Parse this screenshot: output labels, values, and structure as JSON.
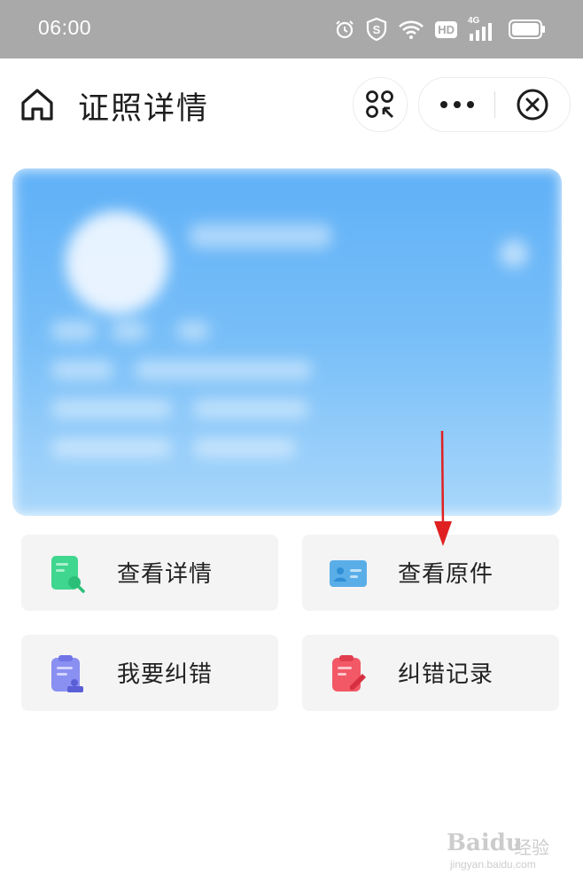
{
  "status_bar": {
    "time": "06:00",
    "icons": [
      "alarm-icon",
      "shield-s-icon",
      "wifi-icon",
      "hd-icon",
      "signal-4g-icon",
      "battery-icon"
    ],
    "hd_text": "HD",
    "network_text": "4G"
  },
  "header": {
    "title": "证照详情",
    "home_icon": "home-icon",
    "scan_icon": "scan-icon",
    "more_icon": "more-icon",
    "close_icon": "close-circle-icon"
  },
  "card": {
    "state": "blurred"
  },
  "actions": [
    {
      "label": "查看详情",
      "icon": "document-search-icon",
      "color": "#3fd68f"
    },
    {
      "label": "查看原件",
      "icon": "id-card-icon",
      "color": "#5aaee8"
    },
    {
      "label": "我要纠错",
      "icon": "clipboard-stamp-icon",
      "color": "#8a8ff2"
    },
    {
      "label": "纠错记录",
      "icon": "clipboard-edit-icon",
      "color": "#f25866"
    }
  ],
  "annotation": {
    "arrow_color": "#e02020"
  },
  "watermark": {
    "brand": "Baidu",
    "cn": "经验",
    "url": "jingyan.baidu.com"
  },
  "colors": {
    "status_bar": "#a9a9a9",
    "card_gradient_top": "#5fb0f7",
    "card_gradient_bottom": "#a9d7fb",
    "action_bg": "#f4f4f4"
  }
}
